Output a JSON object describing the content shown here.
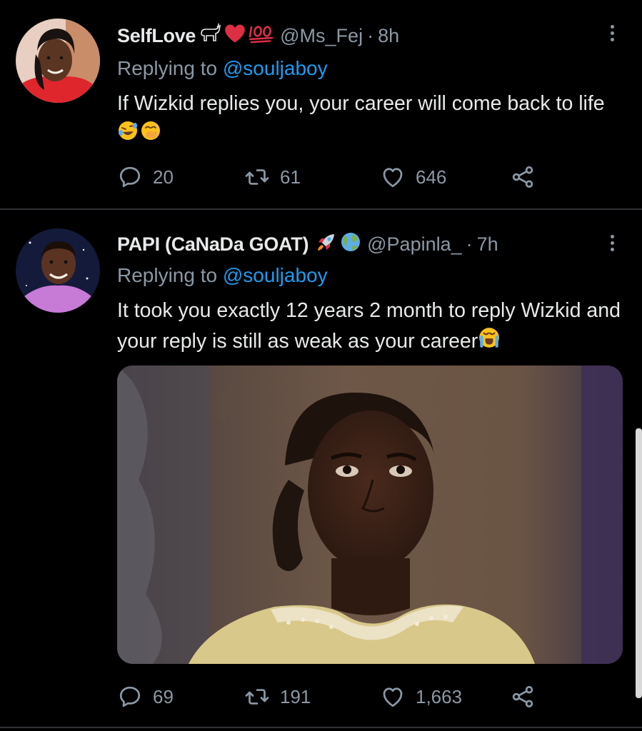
{
  "tweets": [
    {
      "display_name": "SelfLove",
      "name_emojis": [
        "goat",
        "heart",
        "hundred"
      ],
      "handle": "@Ms_Fej",
      "separator": "·",
      "time": "8h",
      "replying_prefix": "Replying to",
      "replying_to": "@souljaboy",
      "text": "If Wizkid replies you, your career will come back to life",
      "text_emojis": [
        "rolling-laughing",
        "hand-over-mouth"
      ],
      "replies": "20",
      "retweets": "61",
      "likes": "646"
    },
    {
      "display_name": "PAPI (CaNaDa GOAT)",
      "name_emojis": [
        "rocket",
        "globe"
      ],
      "handle": "@Papinla_",
      "separator": "·",
      "time": "7h",
      "replying_prefix": "Replying to",
      "replying_to": "@souljaboy",
      "text": "It took you exactly 12 years 2 month to reply Wizkid and your reply is still as weak as your career",
      "text_emojis": [
        "crying-loudly"
      ],
      "media": "photo",
      "replies": "69",
      "retweets": "191",
      "likes": "1,663"
    }
  ],
  "colors": {
    "background": "#000000",
    "text": "#e7e9ea",
    "secondary": "#8b98a5",
    "link": "#1d9bf0",
    "divider": "#2f3336"
  },
  "icons": [
    "reply-icon",
    "retweet-icon",
    "like-icon",
    "share-icon",
    "more-icon"
  ]
}
